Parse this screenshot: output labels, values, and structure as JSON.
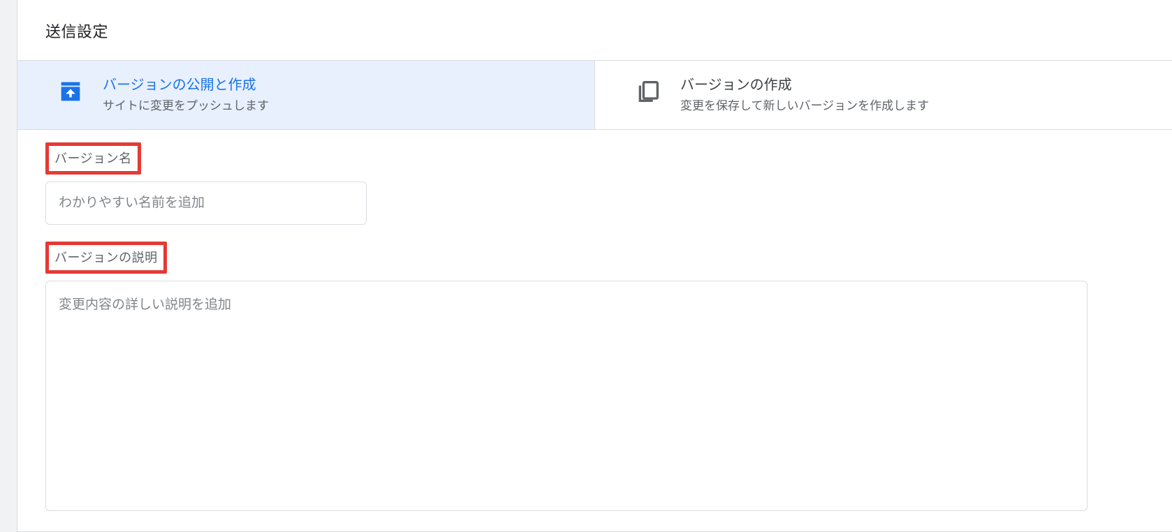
{
  "section_title": "送信設定",
  "options": {
    "publish": {
      "title": "バージョンの公開と作成",
      "desc": "サイトに変更をプッシュします"
    },
    "create": {
      "title": "バージョンの作成",
      "desc": "変更を保存して新しいバージョンを作成します"
    }
  },
  "form": {
    "name_label": "バージョン名",
    "name_placeholder": "わかりやすい名前を追加",
    "desc_label": "バージョンの説明",
    "desc_placeholder": "変更内容の詳しい説明を追加"
  },
  "colors": {
    "accent": "#1a73e8",
    "selected_bg": "#e8f0fe",
    "highlight_border": "#e53935"
  }
}
